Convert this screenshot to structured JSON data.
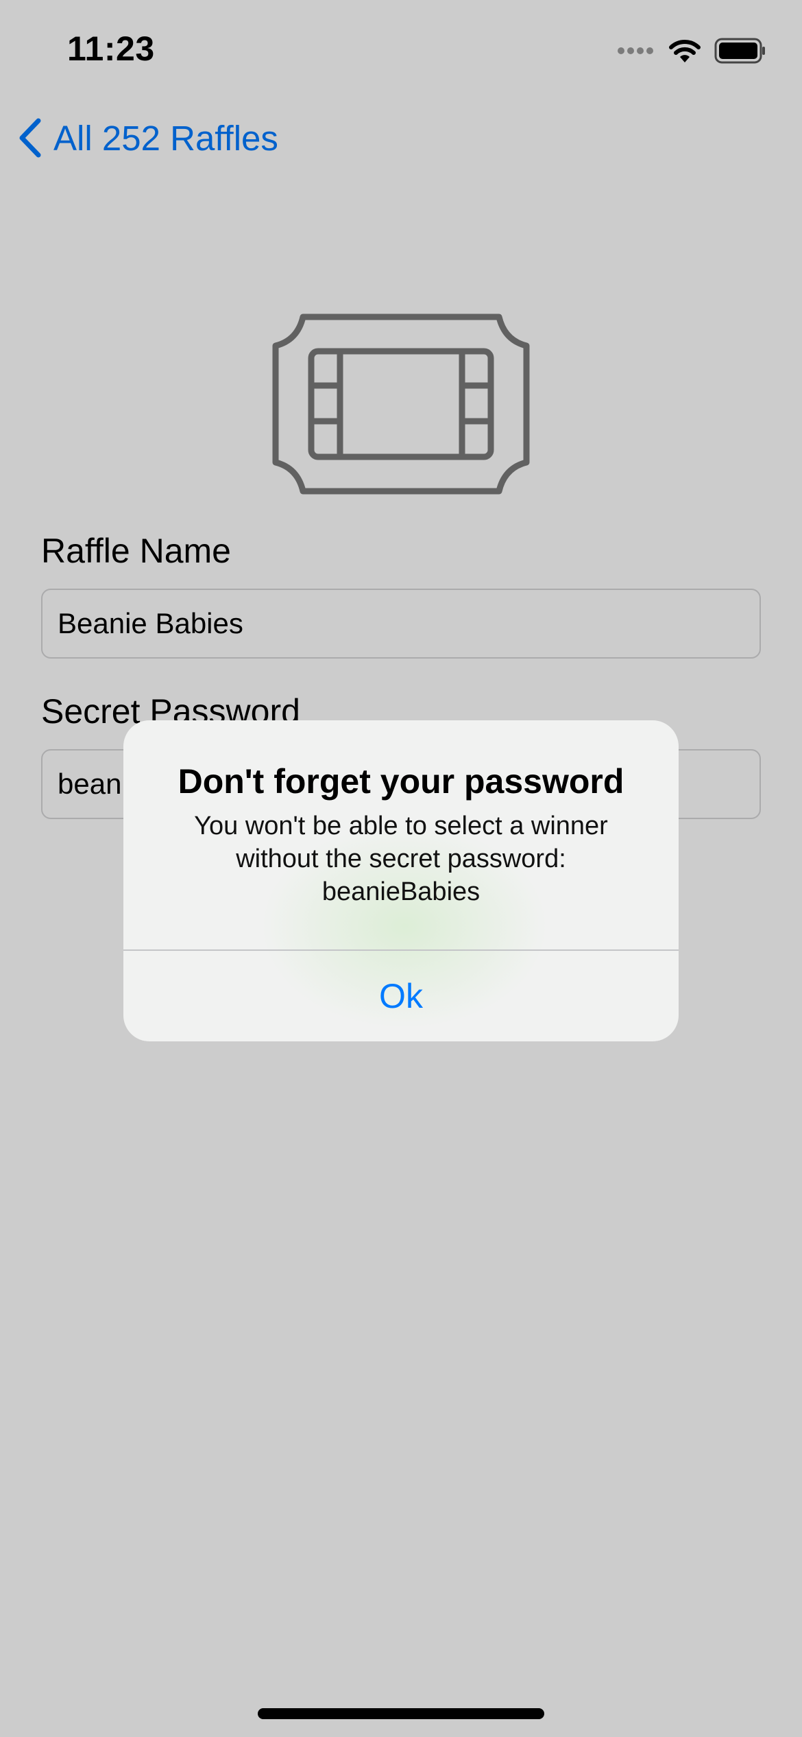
{
  "status_bar": {
    "time": "11:23",
    "signal_icon": "signal-dots-icon",
    "wifi_icon": "wifi-icon",
    "battery_icon": "battery-icon"
  },
  "nav": {
    "back_label": "All 252 Raffles",
    "back_icon": "chevron-left-icon"
  },
  "form": {
    "ticket_icon": "ticket-icon",
    "raffle_name_label": "Raffle Name",
    "raffle_name_value": "Beanie Babies",
    "secret_password_label": "Secret Password",
    "secret_password_value": "beanieBabies"
  },
  "alert": {
    "title": "Don't forget your password",
    "message_line1": "You won't be able to select a winner",
    "message_line2": "without the secret password:",
    "message_line3": "beanieBabies",
    "ok_label": "Ok"
  },
  "colors": {
    "accent": "#007aff",
    "alert_background": "#f1f2f1",
    "dim_overlay": "rgba(0,0,0,0.2)"
  }
}
